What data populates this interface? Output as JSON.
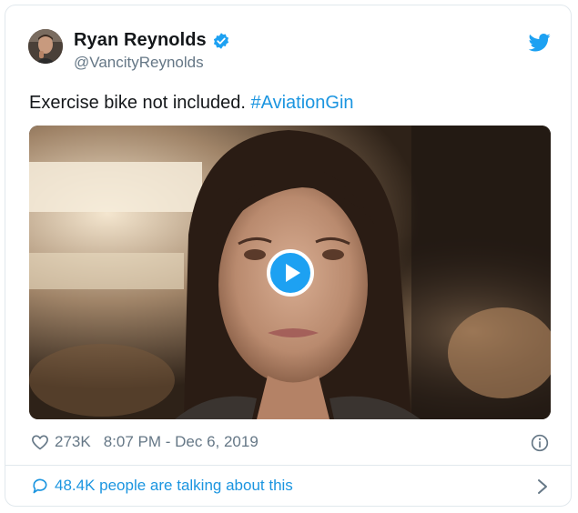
{
  "author": {
    "display_name": "Ryan Reynolds",
    "handle": "@VancityReynolds",
    "avatar_icon": "avatar-photo",
    "verified_icon": "verified-badge-icon"
  },
  "tweet": {
    "text": "Exercise bike not included.",
    "hashtag": "#AviationGin"
  },
  "media": {
    "type": "video",
    "play_icon": "play-icon"
  },
  "meta": {
    "likes": "273K",
    "timestamp": "8:07 PM - Dec 6, 2019"
  },
  "footer": {
    "talking": "48.4K people are talking about this"
  },
  "colors": {
    "accent": "#1b95e0",
    "secondary_text": "#657786",
    "border": "#e1e8ed"
  }
}
